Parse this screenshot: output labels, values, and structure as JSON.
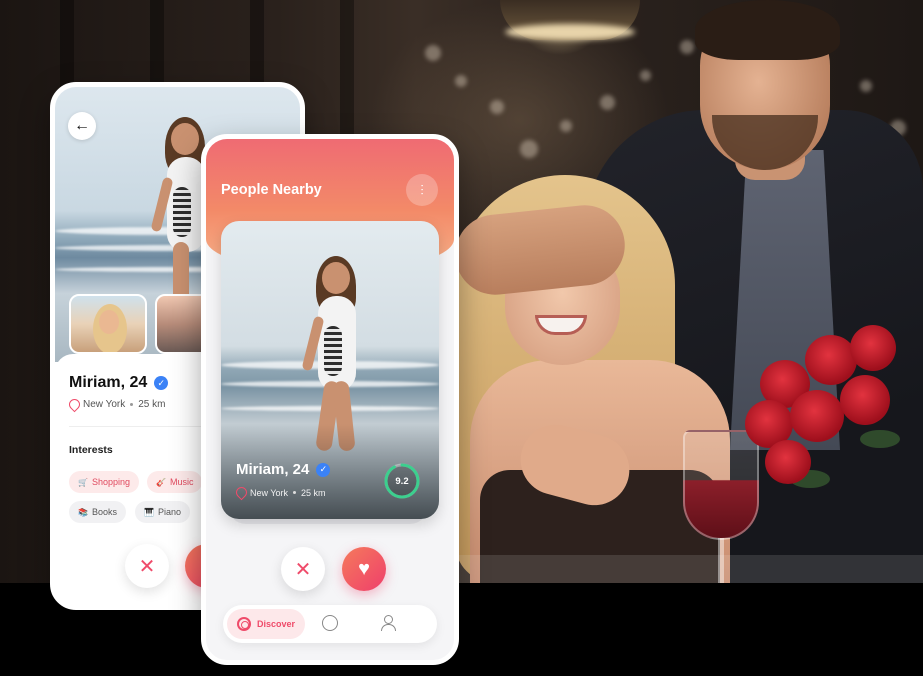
{
  "profile": {
    "name": "Miriam, 24",
    "city": "New York",
    "distance": "25 km",
    "interests_title": "Interests",
    "interests": [
      {
        "label": "Shopping",
        "icon": "shopping-cart-icon",
        "style": "pink"
      },
      {
        "label": "Music",
        "icon": "guitar-icon",
        "style": "pink"
      },
      {
        "label": "Books",
        "icon": "books-icon",
        "style": "gray"
      },
      {
        "label": "Piano",
        "icon": "piano-icon",
        "style": "gray"
      }
    ]
  },
  "nearby": {
    "title": "People Nearby",
    "card": {
      "name": "Miriam, 24",
      "city": "New York",
      "distance": "25 km",
      "score": "9.2",
      "score_fraction": 0.92
    }
  },
  "nav": {
    "discover_label": "Discover"
  },
  "colors": {
    "accent": "#ef4b6a",
    "gradient_start": "#f57a5c",
    "gradient_end": "#ef3f6b",
    "score_ring": "#3ccf8e",
    "verified": "#3b82f6"
  },
  "glyphs": {
    "back_arrow": "←",
    "close": "✕",
    "heart": "♥",
    "check": "✓",
    "filter": "⫶",
    "shopping": "🛒",
    "music": "🎸",
    "books": "📚",
    "piano": "🎹"
  }
}
